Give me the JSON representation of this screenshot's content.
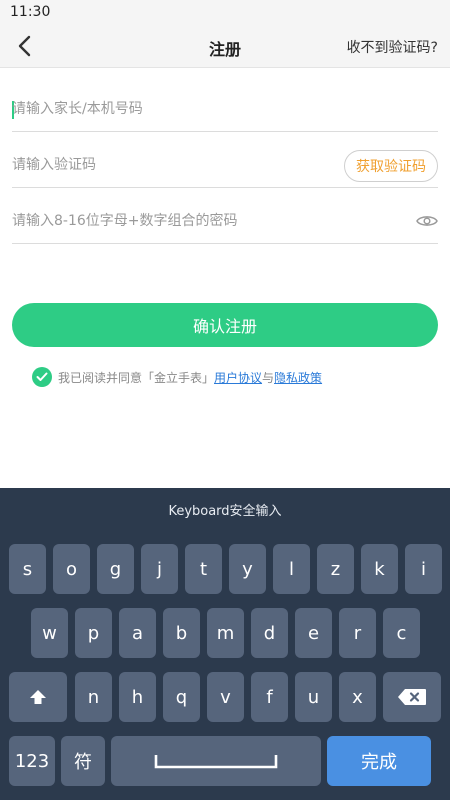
{
  "status": {
    "time": "11:30"
  },
  "nav": {
    "title": "注册",
    "right_link": "收不到验证码?"
  },
  "form": {
    "phone_placeholder": "请输入家长/本机号码",
    "code_placeholder": "请输入验证码",
    "get_code_label": "获取验证码",
    "password_placeholder": "请输入8-16位字母+数字组合的密码",
    "confirm_label": "确认注册"
  },
  "agreement": {
    "text": "我已阅读并同意「金立手表」",
    "user_agreement": "用户协议",
    "conjunction": "与",
    "privacy_policy": "隐私政策",
    "checked": true
  },
  "keyboard": {
    "title": "Keyboard安全输入",
    "row1": [
      "s",
      "o",
      "g",
      "j",
      "t",
      "y",
      "l",
      "z",
      "k",
      "i"
    ],
    "row2": [
      "w",
      "p",
      "a",
      "b",
      "m",
      "d",
      "e",
      "r",
      "c"
    ],
    "row3": [
      "n",
      "h",
      "q",
      "v",
      "f",
      "u",
      "x"
    ],
    "num_label": "123",
    "symbol_label": "符",
    "done_label": "完成",
    "shift_icon": "shift-icon",
    "backspace_icon": "backspace-icon",
    "space_icon": "space-icon"
  },
  "colors": {
    "accent": "#2ecc85",
    "link": "#2a7ad8",
    "code_button_text": "#f0a030",
    "keyboard_bg": "#2c3a4d",
    "key_bg": "#56657c",
    "done_bg": "#4a90e2"
  }
}
